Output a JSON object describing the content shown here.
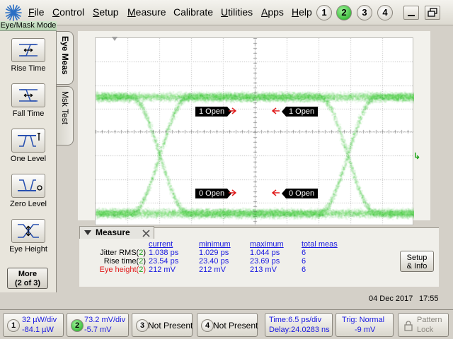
{
  "menu": {
    "items": [
      {
        "label": "File",
        "u": "F",
        "rest": "ile"
      },
      {
        "label": "Control",
        "u": "C",
        "rest": "ontrol"
      },
      {
        "label": "Setup",
        "u": "S",
        "rest": "etup"
      },
      {
        "label": "Measure",
        "u": "M",
        "rest": "easure"
      },
      {
        "label": "Calibrate",
        "u": "",
        "rest": "Calibrate"
      },
      {
        "label": "Utilities",
        "u": "U",
        "rest": "tilities"
      },
      {
        "label": "Apps",
        "u": "A",
        "rest": "pps"
      },
      {
        "label": "Help",
        "u": "H",
        "rest": "elp"
      }
    ],
    "channels": [
      "1",
      "2",
      "3",
      "4"
    ],
    "active_channel": "2"
  },
  "left_panel": {
    "title": "Eye/Mask Mode",
    "tools": [
      {
        "label": "Rise Time",
        "icon": "rise-time-icon"
      },
      {
        "label": "Fall Time",
        "icon": "fall-time-icon"
      },
      {
        "label": "One Level",
        "icon": "one-level-icon"
      },
      {
        "label": "Zero Level",
        "icon": "zero-level-icon"
      },
      {
        "label": "Eye Height",
        "icon": "eye-height-icon"
      }
    ],
    "more_line1": "More",
    "more_line2": "(2 of 3)"
  },
  "tabs": {
    "eye_meas": "Eye Meas",
    "msk_test": "Msk Test"
  },
  "eye_labels": {
    "top_left": "1 Open",
    "top_right": "1 Open",
    "bottom_left": "0 Open",
    "bottom_right": "0 Open"
  },
  "measure": {
    "title": "Measure",
    "headers": {
      "current": "current",
      "minimum": "minimum",
      "maximum": "maximum",
      "total": "total meas"
    },
    "rows": [
      {
        "name": "Jitter RMS(",
        "ch": "2",
        "close": ")",
        "current": "1.038 ps",
        "minimum": "1.029 ps",
        "maximum": "1.044 ps",
        "total": "6",
        "color": "black"
      },
      {
        "name": "Rise time(",
        "ch": "2",
        "close": ")",
        "current": "23.54 ps",
        "minimum": "23.40 ps",
        "maximum": "23.69 ps",
        "total": "6",
        "color": "black"
      },
      {
        "name": "Eye height(",
        "ch": "2",
        "close": ")",
        "current": "212 mV",
        "minimum": "212 mV",
        "maximum": "213 mV",
        "total": "6",
        "color": "red"
      }
    ],
    "setup_line1": "Setup",
    "setup_line2": "& Info"
  },
  "datetime": {
    "date": "04 Dec 2017",
    "time": "17:55"
  },
  "status": {
    "ch1": {
      "num": "1",
      "line1": "32 µW/div",
      "line2": "-84.1 µW"
    },
    "ch2": {
      "num": "2",
      "line1": "73.2 mV/div",
      "line2": "-5.7 mV"
    },
    "ch3": {
      "num": "3",
      "text": "Not Present"
    },
    "ch4": {
      "num": "4",
      "text": "Not Present"
    },
    "timebase": {
      "line1": "Time:6.5 ps/div",
      "line2": "Delay:24.0283 ns"
    },
    "trigger": {
      "line1": "Trig: Normal",
      "line2": "-9 mV"
    },
    "pattern_lock": {
      "line1": "Pattern",
      "line2": "Lock"
    }
  },
  "colors": {
    "trace": "#22c21c",
    "active_channel": "#18a81a",
    "measure_value": "#1a1ae0",
    "warning_value": "#e01a1a"
  }
}
